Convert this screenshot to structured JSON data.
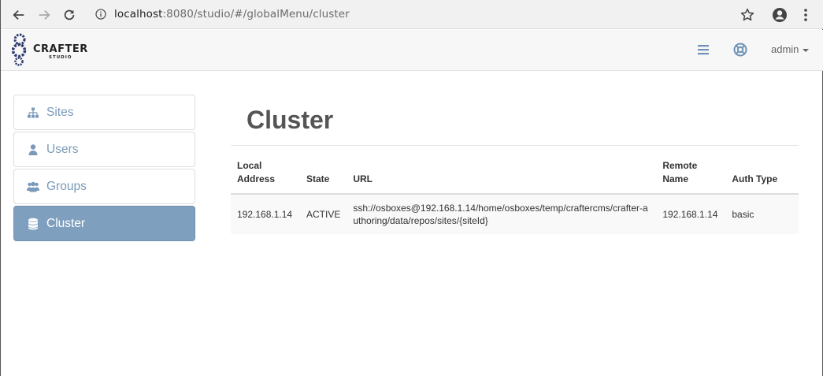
{
  "browser": {
    "url_host": "localhost",
    "url_rest": ":8080/studio/#/globalMenu/cluster"
  },
  "header": {
    "logo_word": "CRAFTER",
    "logo_sub": "STUDIO",
    "user": "admin"
  },
  "sidebar": {
    "items": [
      {
        "label": "Sites",
        "icon": "sitemap-icon"
      },
      {
        "label": "Users",
        "icon": "user-icon"
      },
      {
        "label": "Groups",
        "icon": "users-icon"
      },
      {
        "label": "Cluster",
        "icon": "database-icon",
        "active": true
      }
    ]
  },
  "main": {
    "title": "Cluster",
    "table": {
      "headers": [
        "Local Address",
        "State",
        "URL",
        "Remote Name",
        "Auth Type"
      ],
      "rows": [
        [
          "192.168.1.14",
          "ACTIVE",
          "ssh://osboxes@192.168.1.14/home/osboxes/temp/craftercms/crafter-authoring/data/repos/sites/{siteId}",
          "192.168.1.14",
          "basic"
        ]
      ]
    }
  },
  "colors": {
    "accent": "#7f9fbe",
    "link": "#7b9ab9",
    "title": "#555555"
  }
}
